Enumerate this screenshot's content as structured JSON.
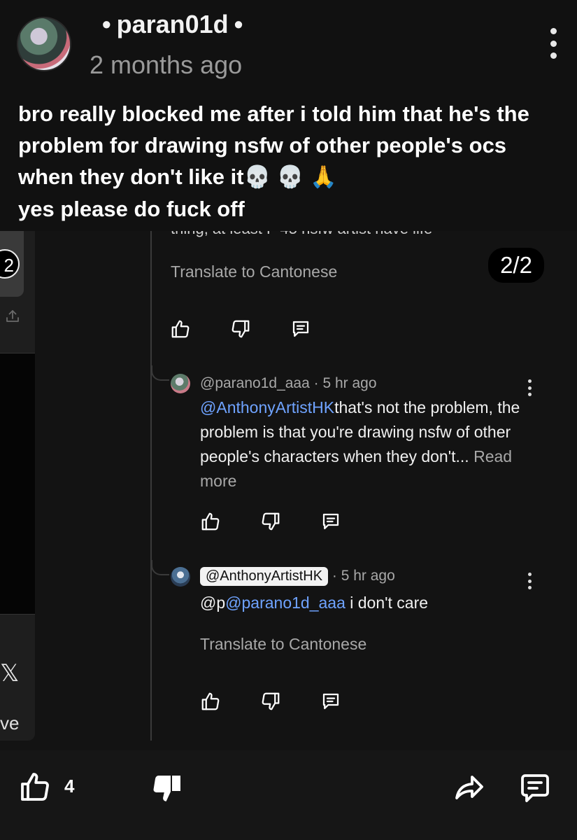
{
  "post": {
    "username": "paran01d",
    "separator": "•",
    "time": "2 months ago",
    "text_main": "bro really blocked me after i told him that he's the problem for drawing nsfw of other people's ocs when they don't like it",
    "emoji_1": "💀",
    "emoji_2": "💀",
    "emoji_3": "🙏",
    "text_end": "yes please do fuck off"
  },
  "embedded": {
    "left": {
      "badge_number": "2",
      "x_glyph": "𝕏",
      "partial_text": "ve"
    },
    "cut_text": "thing, at least F 45 nsfw artist have life",
    "translate_label": "Translate to Cantonese",
    "image_counter": "2/2",
    "replies": [
      {
        "handle": "@parano1d_aaa",
        "time": "5 hr ago",
        "mention": "@AnthonyArtistHK",
        "body": "that's not the problem, the problem is that you're drawing nsfw of other people's characters when they don't...",
        "read_more": "Read more"
      },
      {
        "handle": "@AnthonyArtistHK",
        "time": "5 hr ago",
        "prefix": "@p",
        "mention": "@parano1d_aaa",
        "body": " i don't care",
        "translate": "Translate to Cantonese"
      }
    ]
  },
  "bottom_bar": {
    "like_count": "4"
  },
  "icons": {
    "like": "thumbs-up-icon",
    "dislike": "thumbs-down-icon",
    "reply": "comment-icon",
    "share": "share-arrow-icon",
    "more": "more-vertical-icon"
  },
  "colors": {
    "background": "#161616",
    "mention": "#6fa3ff",
    "muted": "#a8a8a8"
  }
}
